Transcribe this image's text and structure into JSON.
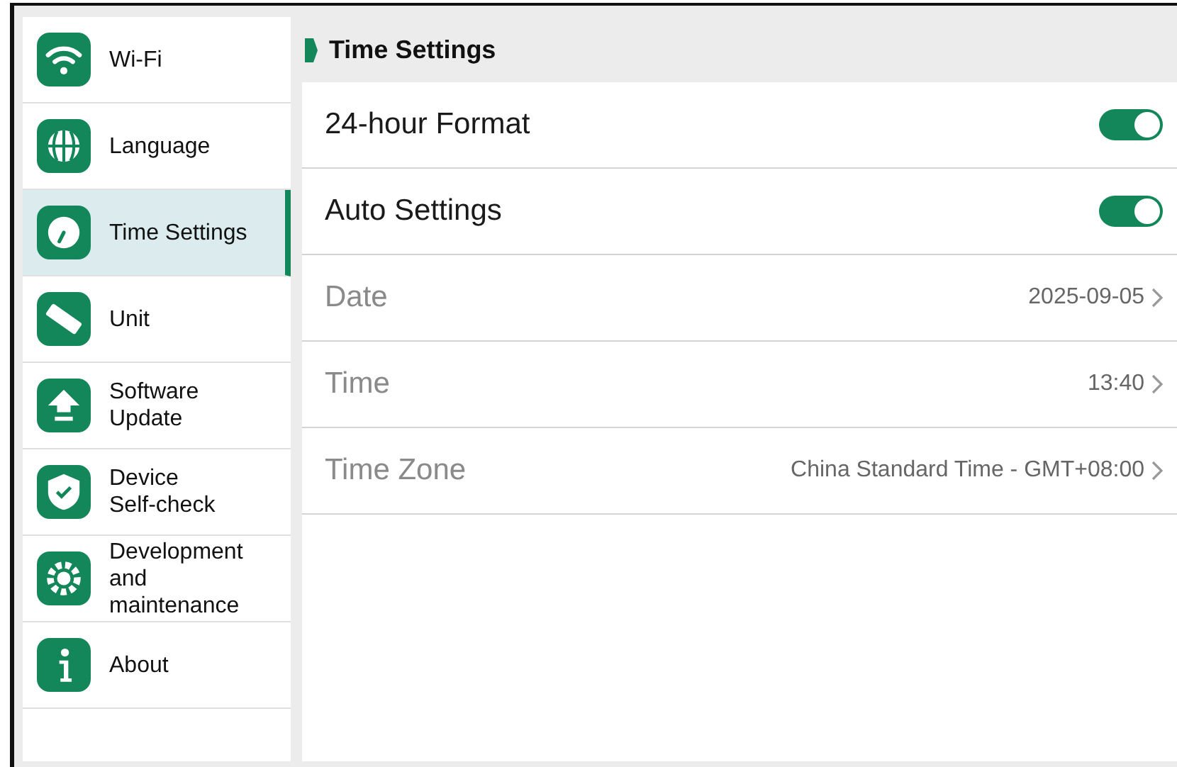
{
  "sidebar": {
    "items": [
      {
        "label": "Wi-Fi",
        "selected": false
      },
      {
        "label": "Language",
        "selected": false
      },
      {
        "label": "Time Settings",
        "selected": true
      },
      {
        "label": "Unit",
        "selected": false
      },
      {
        "label": "Software Update",
        "selected": false
      },
      {
        "label": "Device Self-check",
        "selected": false
      },
      {
        "label": "Development and maintenance",
        "selected": false
      },
      {
        "label": "About",
        "selected": false
      }
    ]
  },
  "panel": {
    "title": "Time Settings",
    "rows": [
      {
        "kind": "toggle",
        "label": "24-hour Format",
        "on": true
      },
      {
        "kind": "toggle",
        "label": "Auto Settings",
        "on": true
      },
      {
        "kind": "value",
        "label": "Date",
        "value": "2025-09-05",
        "disabled": true
      },
      {
        "kind": "value",
        "label": "Time",
        "value": "13:40",
        "disabled": true
      },
      {
        "kind": "value",
        "label": "Time Zone",
        "value": "China Standard Time - GMT+08:00",
        "disabled": true
      }
    ]
  }
}
